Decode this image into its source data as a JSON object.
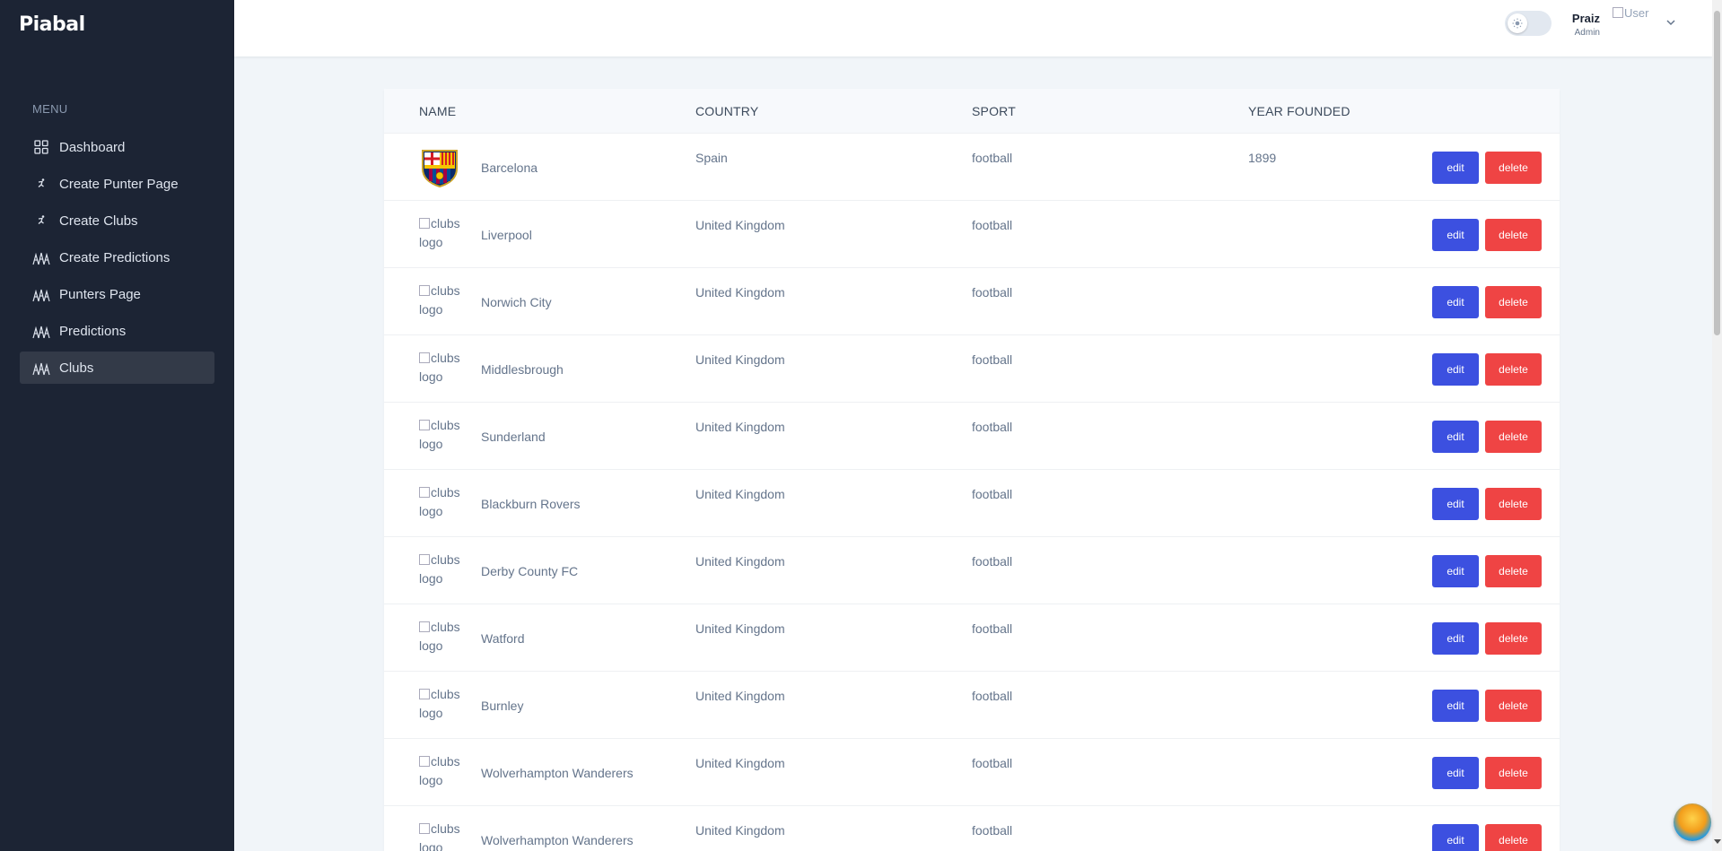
{
  "sidebar": {
    "brand": "Piabal",
    "menu_label": "MENU",
    "items": [
      {
        "label": "Dashboard",
        "icon": "grid-icon"
      },
      {
        "label": "Create Punter Page",
        "icon": "runner-icon"
      },
      {
        "label": "Create Clubs",
        "icon": "runner-icon"
      },
      {
        "label": "Create Predictions",
        "icon": "people-icon"
      },
      {
        "label": "Punters Page",
        "icon": "people-icon"
      },
      {
        "label": "Predictions",
        "icon": "people-icon"
      },
      {
        "label": "Clubs",
        "icon": "people-icon",
        "active": true
      }
    ]
  },
  "header": {
    "user_name": "Praiz",
    "user_role": "Admin",
    "avatar_alt": "User"
  },
  "table": {
    "columns": [
      "NAME",
      "COUNTRY",
      "SPORT",
      "YEAR FOUNDED"
    ],
    "logo_alt": "clubs logo",
    "edit_label": "edit",
    "delete_label": "delete",
    "rows": [
      {
        "name": "Barcelona",
        "country": "Spain",
        "sport": "football",
        "year": "1899",
        "has_logo": true
      },
      {
        "name": "Liverpool",
        "country": "United Kingdom",
        "sport": "football",
        "year": ""
      },
      {
        "name": "Norwich City",
        "country": "United Kingdom",
        "sport": "football",
        "year": ""
      },
      {
        "name": "Middlesbrough",
        "country": "United Kingdom",
        "sport": "football",
        "year": ""
      },
      {
        "name": "Sunderland",
        "country": "United Kingdom",
        "sport": "football",
        "year": ""
      },
      {
        "name": "Blackburn Rovers",
        "country": "United Kingdom",
        "sport": "football",
        "year": ""
      },
      {
        "name": "Derby County FC",
        "country": "United Kingdom",
        "sport": "football",
        "year": ""
      },
      {
        "name": "Watford",
        "country": "United Kingdom",
        "sport": "football",
        "year": ""
      },
      {
        "name": "Burnley",
        "country": "United Kingdom",
        "sport": "football",
        "year": ""
      },
      {
        "name": "Wolverhampton Wanderers",
        "country": "United Kingdom",
        "sport": "football",
        "year": ""
      },
      {
        "name": "Wolverhampton Wanderers",
        "country": "United Kingdom",
        "sport": "football",
        "year": ""
      }
    ]
  },
  "colors": {
    "sidebar_bg": "#1c2434",
    "accent": "#3c50e0",
    "danger": "#ef4444"
  }
}
